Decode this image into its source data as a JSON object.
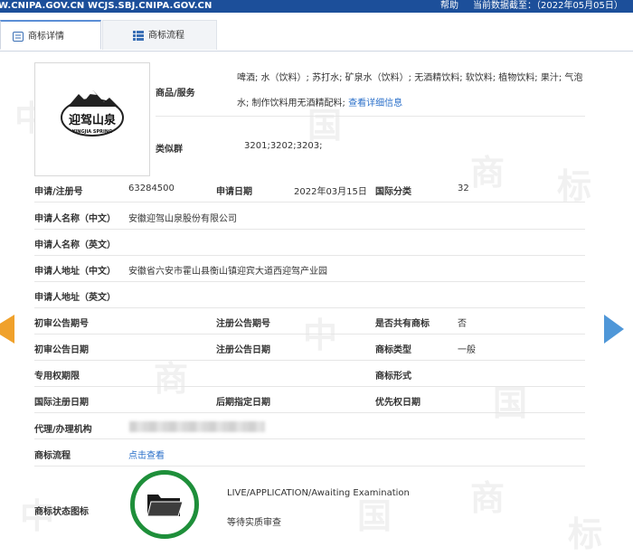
{
  "topbar": {
    "url": "W.CNIPA.GOV.CN WCJS.SBJ.CNIPA.GOV.CN",
    "help": "帮助",
    "data_date": "当前数据截至：（2022年05月05日）"
  },
  "tabs": [
    {
      "label": "商标详情",
      "active": true
    },
    {
      "label": "商标流程",
      "active": false
    }
  ],
  "logo": {
    "brand_cn": "迎驾山泉",
    "brand_en": "YINGJIA SPRING"
  },
  "goods": {
    "label": "商品/服务",
    "text": "啤酒; 水（饮料）; 苏打水; 矿泉水（饮料）; 无酒精饮料; 软饮料; 植物饮料; 果汁; 气泡水; 制作饮料用无酒精配料;",
    "more_link": "查看详细信息"
  },
  "similar_group": {
    "label": "类似群",
    "value": "3201;3202;3203;"
  },
  "reg_no": {
    "label": "申请/注册号",
    "value": "63284500"
  },
  "app_date": {
    "label": "申请日期",
    "value": "2022年03月15日"
  },
  "intl_class": {
    "label": "国际分类",
    "value": "32"
  },
  "applicant_cn": {
    "label": "申请人名称（中文）",
    "value": "安徽迎驾山泉股份有限公司"
  },
  "applicant_en": {
    "label": "申请人名称（英文）",
    "value": ""
  },
  "address_cn": {
    "label": "申请人地址（中文）",
    "value": "安徽省六安市霍山县衡山镇迎宾大道西迎驾产业园"
  },
  "address_en": {
    "label": "申请人地址（英文）",
    "value": ""
  },
  "prelim_pub_no": {
    "label": "初审公告期号"
  },
  "reg_pub_no": {
    "label": "注册公告期号"
  },
  "shared": {
    "label": "是否共有商标",
    "value": "否"
  },
  "prelim_pub_date": {
    "label": "初审公告日期"
  },
  "reg_pub_date": {
    "label": "注册公告日期"
  },
  "tm_type": {
    "label": "商标类型",
    "value": "一般"
  },
  "exclusive_period": {
    "label": "专用权期限"
  },
  "tm_form": {
    "label": "商标形式"
  },
  "intl_reg_date": {
    "label": "国际注册日期"
  },
  "later_date": {
    "label": "后期指定日期"
  },
  "priority_date": {
    "label": "优先权日期"
  },
  "agent": {
    "label": "代理/办理机构"
  },
  "flow": {
    "label": "商标流程",
    "link": "点击查看"
  },
  "status": {
    "label": "商标状态图标",
    "en": "LIVE/APPLICATION/Awaiting Examination",
    "cn": "等待实质审查"
  },
  "watermark": [
    "中",
    "国",
    "商",
    "标"
  ],
  "colors": {
    "topbar": "#1c4f9a",
    "link": "#2a6fc9",
    "status_ring": "#1e8f3a",
    "arrow_left": "#f0a12b",
    "arrow_right": "#4f97d8"
  }
}
